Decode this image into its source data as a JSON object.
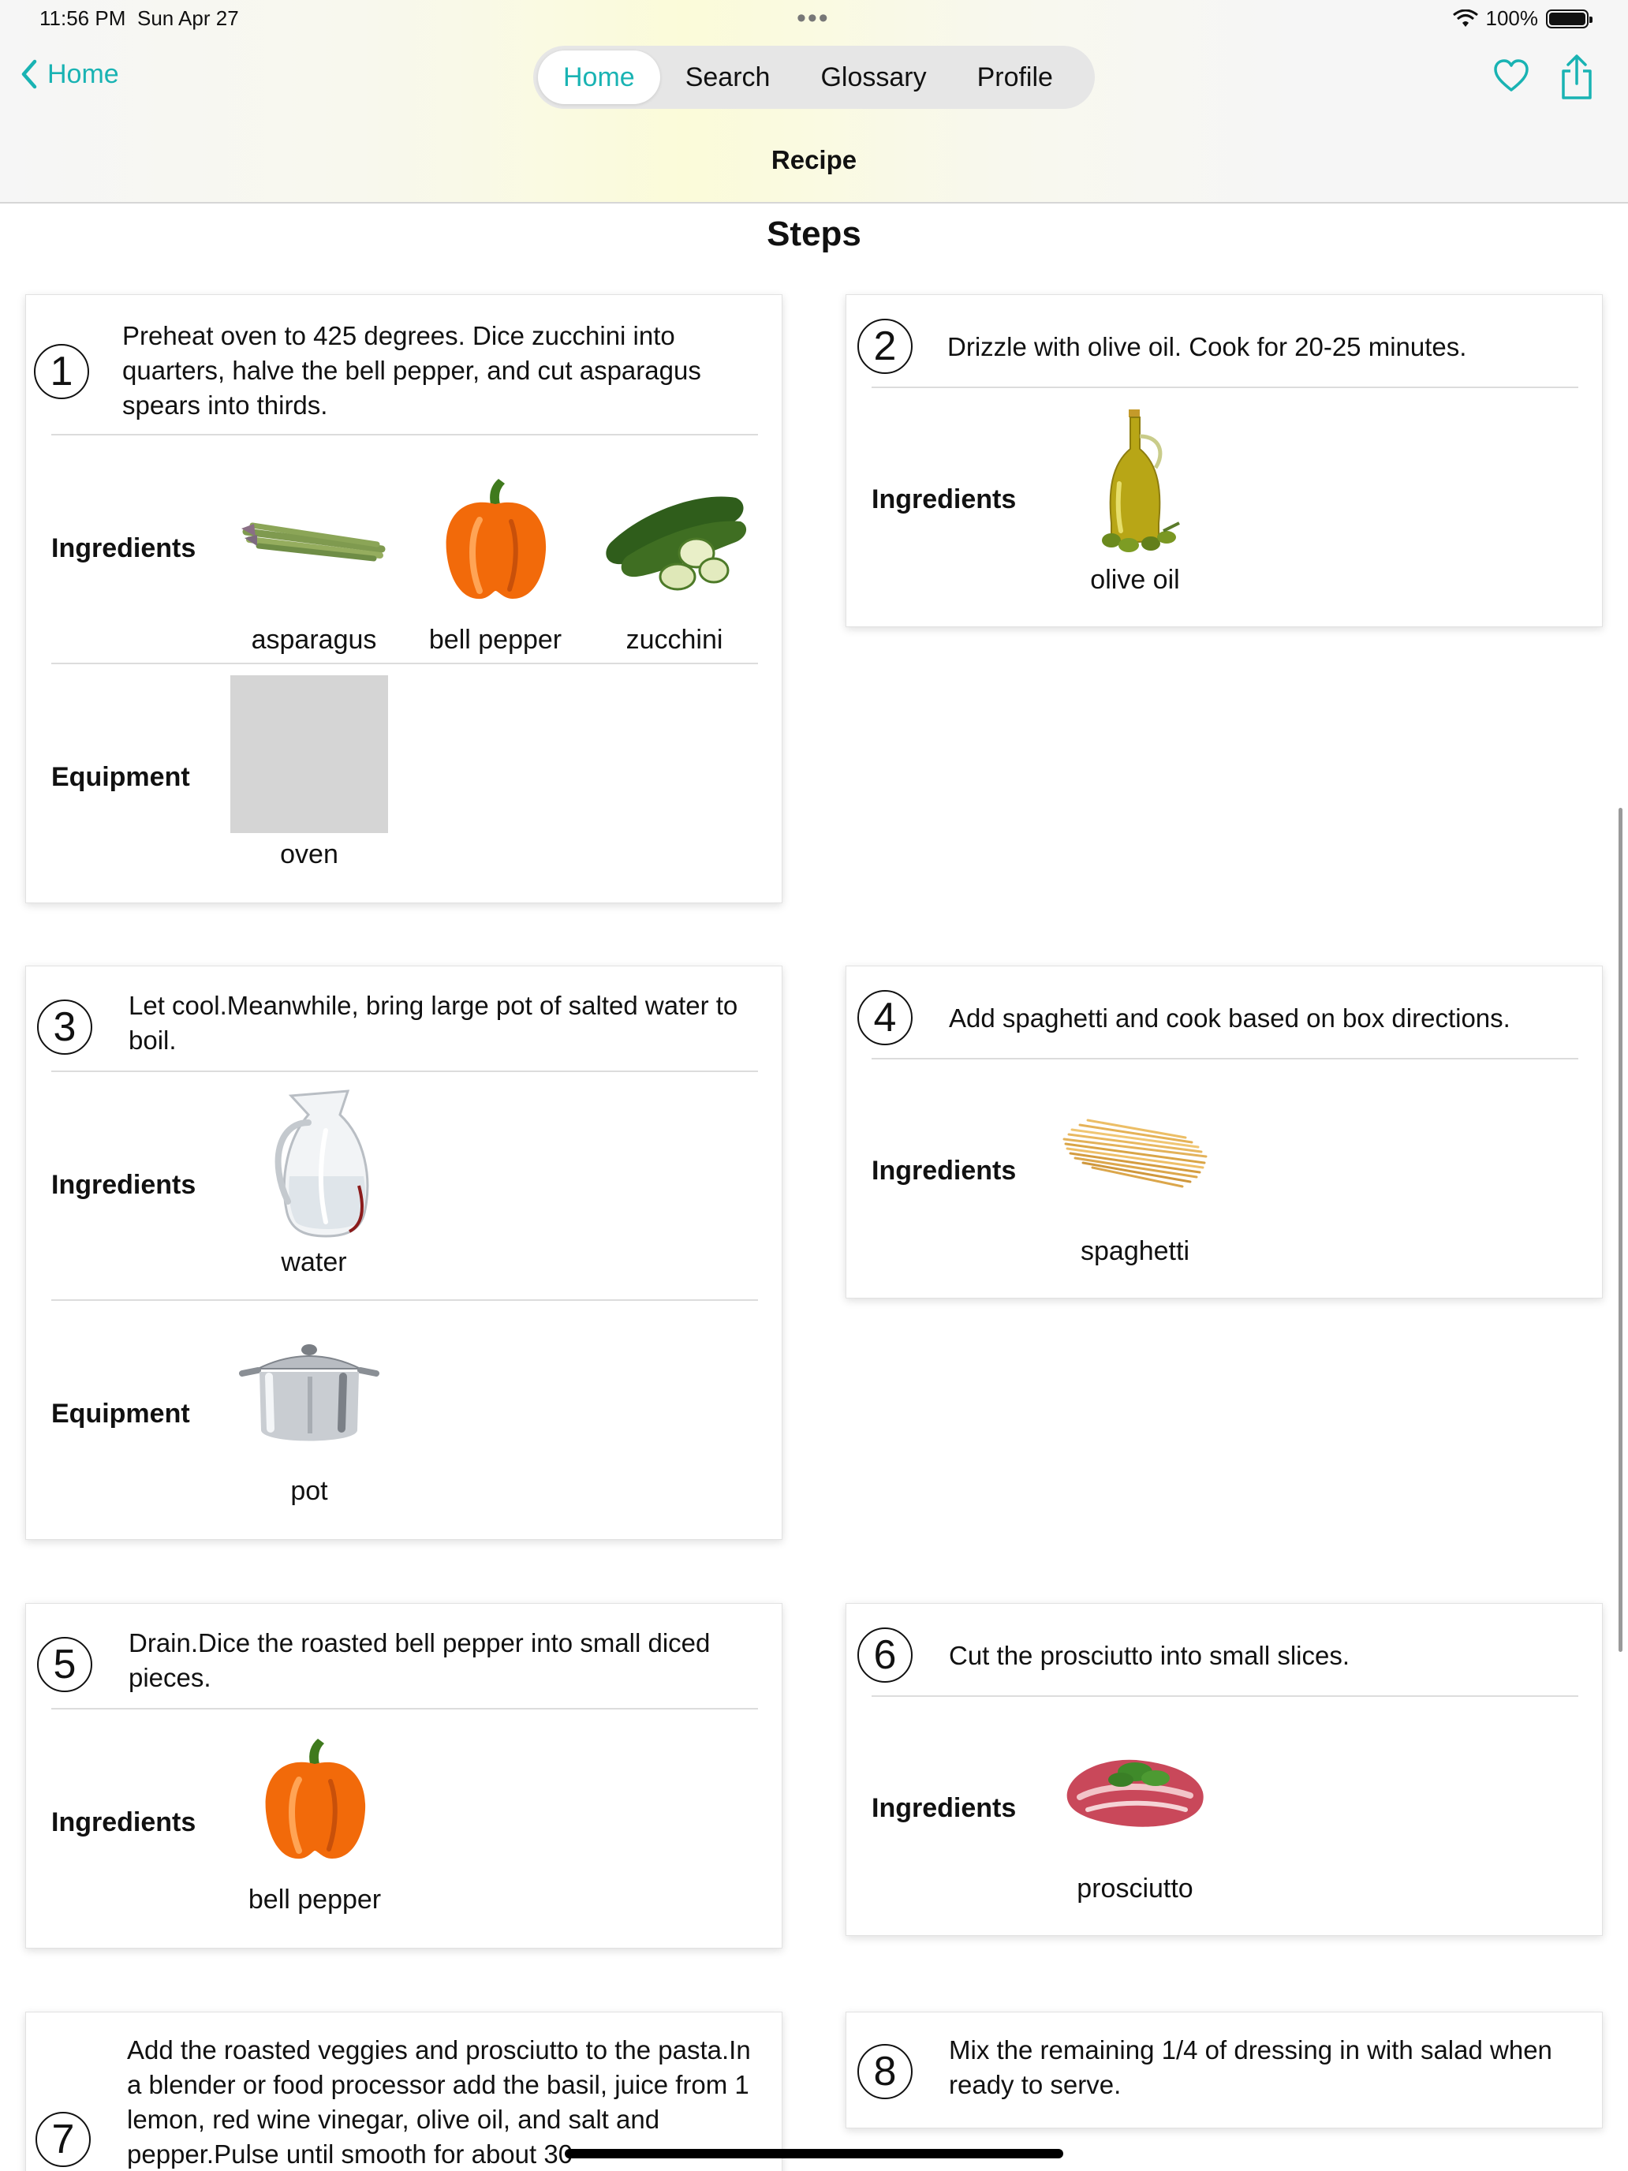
{
  "status": {
    "time": "11:56 PM",
    "date": "Sun Apr 27",
    "battery": "100%"
  },
  "nav": {
    "back_label": "Home",
    "tabs": [
      "Home",
      "Search",
      "Glossary",
      "Profile"
    ],
    "active_tab": "Home",
    "title": "Recipe"
  },
  "labels": {
    "steps": "Steps",
    "ingredients": "Ingredients",
    "equipment": "Equipment"
  },
  "steps": [
    {
      "num": "1",
      "text": "Preheat oven to 425 degrees. Dice zucchini into quarters, halve the bell pepper, and cut asparagus spears into thirds.",
      "ingredients": [
        "asparagus",
        "bell pepper",
        "zucchini"
      ],
      "equipment": [
        "oven"
      ]
    },
    {
      "num": "2",
      "text": "Drizzle with olive oil. Cook for 20-25 minutes.",
      "ingredients": [
        "olive oil"
      ]
    },
    {
      "num": "3",
      "text": "Let cool.Meanwhile, bring large pot of salted water to boil.",
      "ingredients": [
        "water"
      ],
      "equipment": [
        "pot"
      ]
    },
    {
      "num": "4",
      "text": "Add spaghetti and cook based on box directions.",
      "ingredients": [
        "spaghetti"
      ]
    },
    {
      "num": "5",
      "text": "Drain.Dice the roasted bell pepper into small diced pieces.",
      "ingredients": [
        "bell pepper"
      ]
    },
    {
      "num": "6",
      "text": "Cut the prosciutto into small slices.",
      "ingredients": [
        "prosciutto"
      ]
    },
    {
      "num": "7",
      "text": "Add the roasted veggies and prosciutto to the pasta.In a blender or food processor add the basil, juice from 1 lemon, red wine vinegar, olive oil, and salt and pepper.Pulse until smooth for about 30"
    },
    {
      "num": "8",
      "text": "Mix the remaining 1/4 of dressing in with salad when ready to serve."
    }
  ],
  "colors": {
    "accent": "#19b3b3",
    "tab_bg": "#e6e6e6",
    "pepper": "#f26a0a",
    "zucchini": "#3f6e22"
  }
}
